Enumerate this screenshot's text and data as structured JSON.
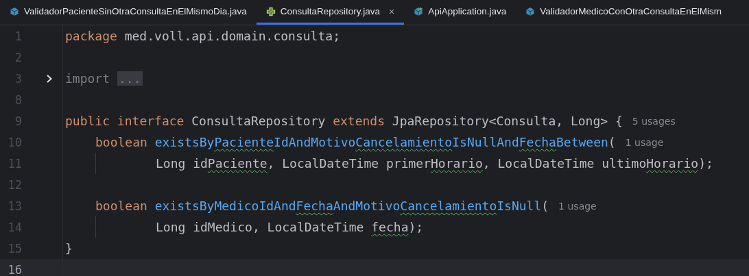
{
  "tabs": [
    {
      "label": "ValidadorPacienteSinOtraConsultaEnElMismoDia.java",
      "kind": "class",
      "selected": false
    },
    {
      "label": "ConsultaRepository.java",
      "kind": "interface",
      "selected": true,
      "close": "×"
    },
    {
      "label": "ApiApplication.java",
      "kind": "application",
      "selected": false
    },
    {
      "label": "ValidadorMedicoConOtraConsultaEnElMism",
      "kind": "class",
      "selected": false
    }
  ],
  "lines": [
    {
      "number": "1",
      "kind": "top",
      "current": false,
      "tokens": [
        {
          "kind": "keyword",
          "text": "package"
        },
        {
          "kind": "plain",
          "text": " med.voll.api.domain.consulta;"
        }
      ]
    },
    {
      "number": "2",
      "kind": "top",
      "current": false
    },
    {
      "number": "3",
      "kind": "top",
      "current": false,
      "folded": true,
      "tokens": [
        {
          "kind": "muted",
          "text": "import"
        }
      ],
      "placeholder": "..."
    },
    {
      "number": "8",
      "kind": "top",
      "current": false
    },
    {
      "number": "9",
      "kind": "top",
      "current": false,
      "tokens": [
        {
          "kind": "keyword",
          "text": "public"
        },
        {
          "kind": "keyword",
          "text": " interface"
        },
        {
          "kind": "plain",
          "text": " ConsultaRepository"
        },
        {
          "kind": "keyword",
          "text": " extends"
        },
        {
          "kind": "plain",
          "text": " JpaRepository<Consulta, Long> {"
        }
      ],
      "hint": "5 usages"
    },
    {
      "number": "10",
      "kind": "member",
      "current": false,
      "tokens": [
        {
          "kind": "keyword",
          "text": "boolean"
        },
        {
          "kind": "method",
          "text": " existsBy"
        },
        {
          "kind": "method",
          "text": "Paciente",
          "typo": true
        },
        {
          "kind": "method",
          "text": "IdAndMotivo"
        },
        {
          "kind": "method",
          "text": "Cancelamiento",
          "typo": true
        },
        {
          "kind": "method",
          "text": "IsNullAnd"
        },
        {
          "kind": "method",
          "text": "Fecha",
          "typo": true
        },
        {
          "kind": "method",
          "text": "Between"
        },
        {
          "kind": "plain",
          "text": "("
        }
      ],
      "hint": "1 usage"
    },
    {
      "number": "11",
      "kind": "continuation",
      "current": false,
      "guide": true,
      "tokens": [
        {
          "kind": "plain",
          "text": "Long id"
        },
        {
          "kind": "plain",
          "text": "Paciente",
          "typo": true
        },
        {
          "kind": "plain",
          "text": ", LocalDateTime primer"
        },
        {
          "kind": "plain",
          "text": "Horario",
          "typo": true
        },
        {
          "kind": "plain",
          "text": ", LocalDateTime ultimo"
        },
        {
          "kind": "plain",
          "text": "Horario",
          "typo": true
        },
        {
          "kind": "plain",
          "text": ");"
        }
      ]
    },
    {
      "number": "12",
      "kind": "top",
      "current": false
    },
    {
      "number": "13",
      "kind": "member",
      "current": false,
      "tokens": [
        {
          "kind": "keyword",
          "text": "boolean"
        },
        {
          "kind": "method",
          "text": " existsByMedicoIdAnd"
        },
        {
          "kind": "method",
          "text": "Fecha",
          "typo": true
        },
        {
          "kind": "method",
          "text": "AndMotivo"
        },
        {
          "kind": "method",
          "text": "Cancelamiento",
          "typo": true
        },
        {
          "kind": "method",
          "text": "IsNull"
        },
        {
          "kind": "plain",
          "text": "("
        }
      ],
      "hint": "1 usage"
    },
    {
      "number": "14",
      "kind": "continuation",
      "current": false,
      "guide": true,
      "tokens": [
        {
          "kind": "plain",
          "text": "Long idMedico, LocalDateTime "
        },
        {
          "kind": "plain",
          "text": "fecha",
          "typo": true
        },
        {
          "kind": "plain",
          "text": ");"
        }
      ]
    },
    {
      "number": "15",
      "kind": "top",
      "current": false,
      "tokens": [
        {
          "kind": "plain",
          "text": "}"
        }
      ]
    },
    {
      "number": "16",
      "kind": "top",
      "current": true
    }
  ]
}
